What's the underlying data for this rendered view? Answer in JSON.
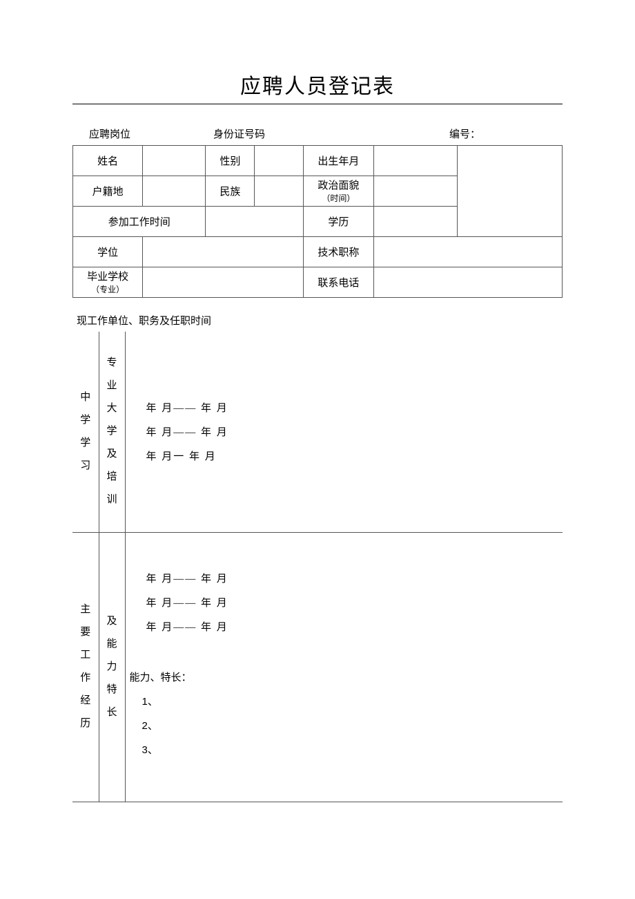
{
  "title": "应聘人员登记表",
  "header": {
    "position_label": "应聘岗位",
    "id_label": "身份证号码",
    "serial_label": "编号："
  },
  "fields": {
    "name_label": "姓名",
    "gender_label": "性别",
    "birth_label": "出生年月",
    "residence_label": "户籍地",
    "ethnicity_label": "民族",
    "political_label": "政治面貌",
    "political_sub": "（时间）",
    "work_start_label": "参加工作时间",
    "education_label": "学历",
    "degree_label": "学位",
    "tech_title_label": "技术职称",
    "grad_school_label": "毕业学校",
    "grad_school_sub": "（专业）",
    "phone_label": "联系电话"
  },
  "current_work_label": "现工作单位、职务及任职时间",
  "section_labels": {
    "col1_row1": "中学学习",
    "col2_row1": "专业大学及培训",
    "col1_row2": "主要工作经历",
    "col2_row2": "及能力特长"
  },
  "date_lines": {
    "line1": "年  月——      年  月",
    "line2": "年  月——      年  月",
    "line3": "年  月一       年  月",
    "work_line1": "年  月——     年  月",
    "work_line2": "年  月——     年  月",
    "work_line3": "年  月——     年  月"
  },
  "ability": {
    "title": "能力、特长：",
    "item1": "1、",
    "item2": "2、",
    "item3": "3、"
  }
}
